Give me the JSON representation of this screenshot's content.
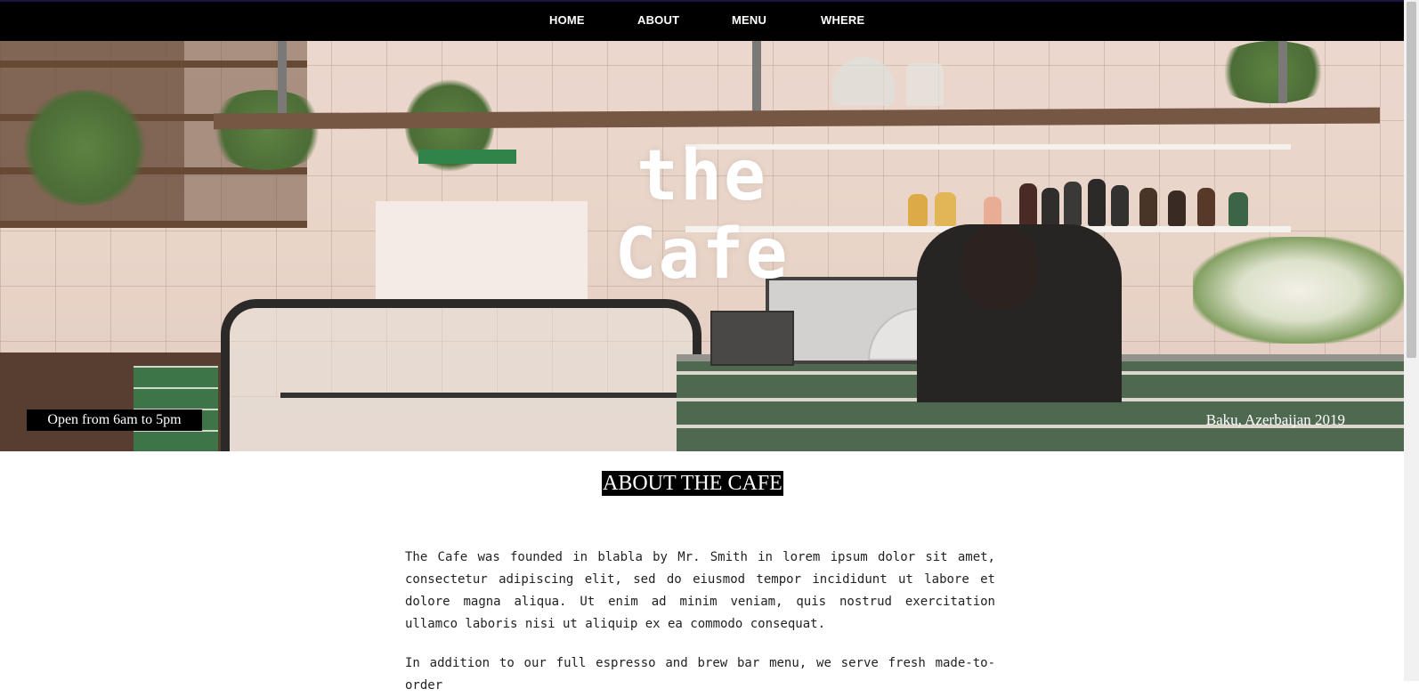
{
  "nav": {
    "items": [
      "HOME",
      "ABOUT",
      "MENU",
      "WHERE"
    ]
  },
  "hero": {
    "title_line1": "the",
    "title_line2": "Cafe",
    "hours": "Open from 6am to 5pm",
    "location": "Baku, Azerbaijan 2019"
  },
  "about": {
    "heading": "ABOUT THE CAFE",
    "paragraphs": [
      "The Cafe was founded in blabla by Mr. Smith in lorem ipsum dolor sit amet, consectetur adipiscing elit, sed do eiusmod tempor incididunt ut labore et dolore magna aliqua. Ut enim ad minim veniam, quis nostrud exercitation ullamco laboris nisi ut aliquip ex ea commodo consequat.",
      "In addition to our full espresso and brew bar menu, we serve fresh made-to-order"
    ]
  },
  "colors": {
    "navbar": "#000000",
    "accent_line": "#1b1440",
    "heading_bg": "#000000",
    "text": "#222222"
  }
}
